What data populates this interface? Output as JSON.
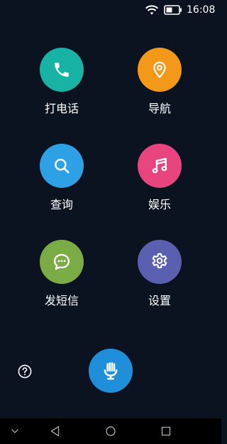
{
  "status_bar": {
    "time": "16:08",
    "icons": [
      "wifi-icon",
      "battery-icon"
    ]
  },
  "apps": {
    "call": {
      "label": "打电话",
      "icon": "phone-icon",
      "color": "#19b3a6"
    },
    "navigation": {
      "label": "导航",
      "icon": "location-pin-icon",
      "color": "#f39819"
    },
    "search": {
      "label": "查询",
      "icon": "search-icon",
      "color": "#2ea0e6"
    },
    "entertainment": {
      "label": "娱乐",
      "icon": "music-note-icon",
      "color": "#e8457f"
    },
    "sms": {
      "label": "发短信",
      "icon": "chat-bubble-icon",
      "color": "#7aab45"
    },
    "settings": {
      "label": "设置",
      "icon": "gear-icon",
      "color": "#5a5fb0"
    }
  },
  "bottom_controls": {
    "help_icon": "help-icon",
    "mic_icon": "microphone-icon",
    "mic_color": "#1e8fd8"
  },
  "nav_bar": {
    "icons": [
      "chevron-down-icon",
      "back-icon",
      "home-icon",
      "recent-apps-icon"
    ]
  }
}
